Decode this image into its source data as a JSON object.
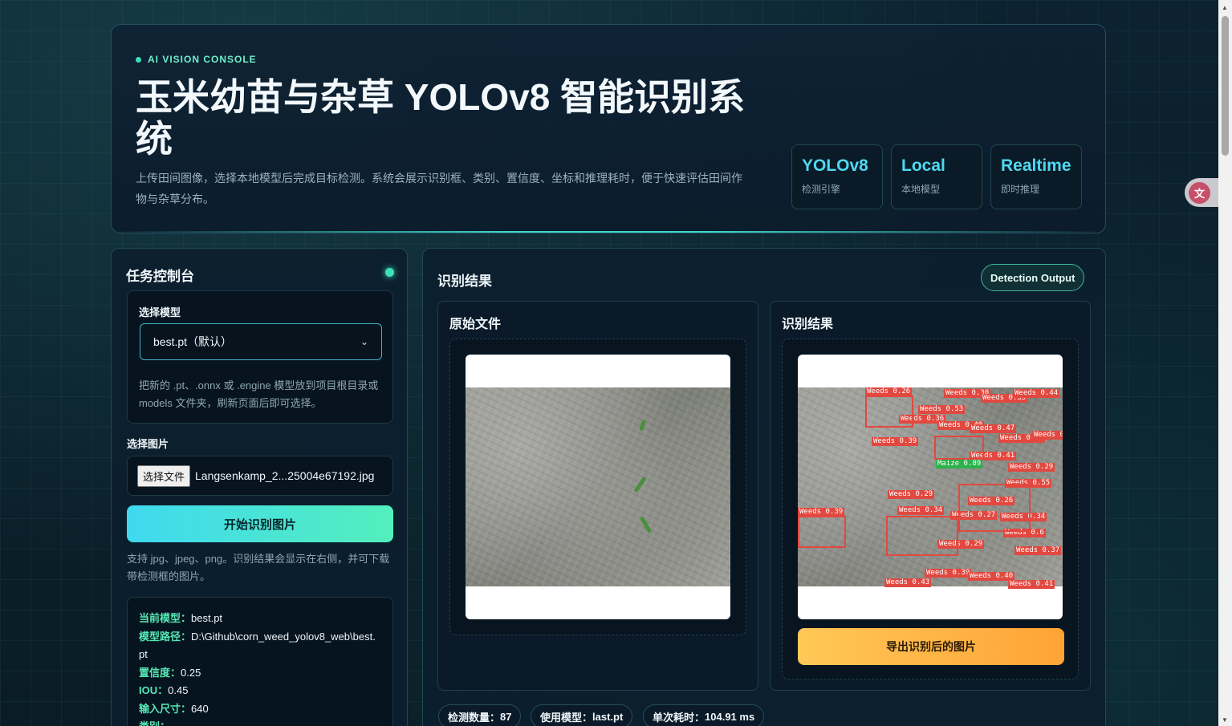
{
  "hero": {
    "eyebrow": "AI VISION CONSOLE",
    "title": "玉米幼苗与杂草 YOLOv8 智能识别系统",
    "description": "上传田间图像，选择本地模型后完成目标检测。系统会展示识别框、类别、置信度、坐标和推理耗时，便于快速评估田间作物与杂草分布。",
    "stats": [
      {
        "value": "YOLOv8",
        "label": "检测引擎"
      },
      {
        "value": "Local",
        "label": "本地模型"
      },
      {
        "value": "Realtime",
        "label": "即时推理"
      }
    ]
  },
  "control": {
    "title": "任务控制台",
    "model_label": "选择模型",
    "model_selected": "best.pt（默认）",
    "model_hint": "把新的 .pt、.onnx 或 .engine 模型放到项目根目录或 models 文件夹，刷新页面后即可选择。",
    "image_label": "选择图片",
    "file_button": "选择文件",
    "file_name": "Langsenkamp_2...25004e67192.jpg",
    "start_button": "开始识别图片",
    "upload_hint": "支持 jpg、jpeg、png。识别结果会显示在右侧，并可下载带检测框的图片。",
    "info": [
      {
        "key": "当前模型：",
        "value": "best.pt"
      },
      {
        "key": "模型路径：",
        "value": "D:\\Github\\corn_weed_yolov8_web\\best.pt"
      },
      {
        "key": "置信度：",
        "value": "0.25"
      },
      {
        "key": "IOU：",
        "value": "0.45"
      },
      {
        "key": "输入尺寸：",
        "value": "640"
      },
      {
        "key": "类别：",
        "value": ""
      }
    ]
  },
  "result": {
    "title": "识别结果",
    "badge": "Detection Output",
    "original_title": "原始文件",
    "detected_title": "识别结果",
    "export_button": "导出识别后的图片",
    "pills": [
      {
        "key": "检测数量：",
        "value": "87"
      },
      {
        "key": "使用模型：",
        "value": "last.pt"
      },
      {
        "key": "单次耗时：",
        "value": "104.91 ms"
      }
    ],
    "detections": [
      "Weeds 0.26",
      "Weeds 0.30",
      "Weeds 0.35",
      "Weeds 0.44",
      "Weeds 0.53",
      "Weeds 0.36",
      "Weeds 0.40",
      "Weeds 0.47",
      "Weeds 0.44",
      "Weeds 0.49",
      "Weeds 0.39",
      "Weeds 0.41",
      "Maize 0.89",
      "Weeds 0.29",
      "Weeds 0.55",
      "Weeds 0.29",
      "Weeds 0.26",
      "Weeds 0.39",
      "Weeds 0.34",
      "Weeds 0.27",
      "Weeds 0.34",
      "Weeds 0.6",
      "Weeds 0.29",
      "Weeds 0.37",
      "Weeds 0.39",
      "Weeds 0.40",
      "Weeds 0.43",
      "Weeds 0.41"
    ]
  }
}
